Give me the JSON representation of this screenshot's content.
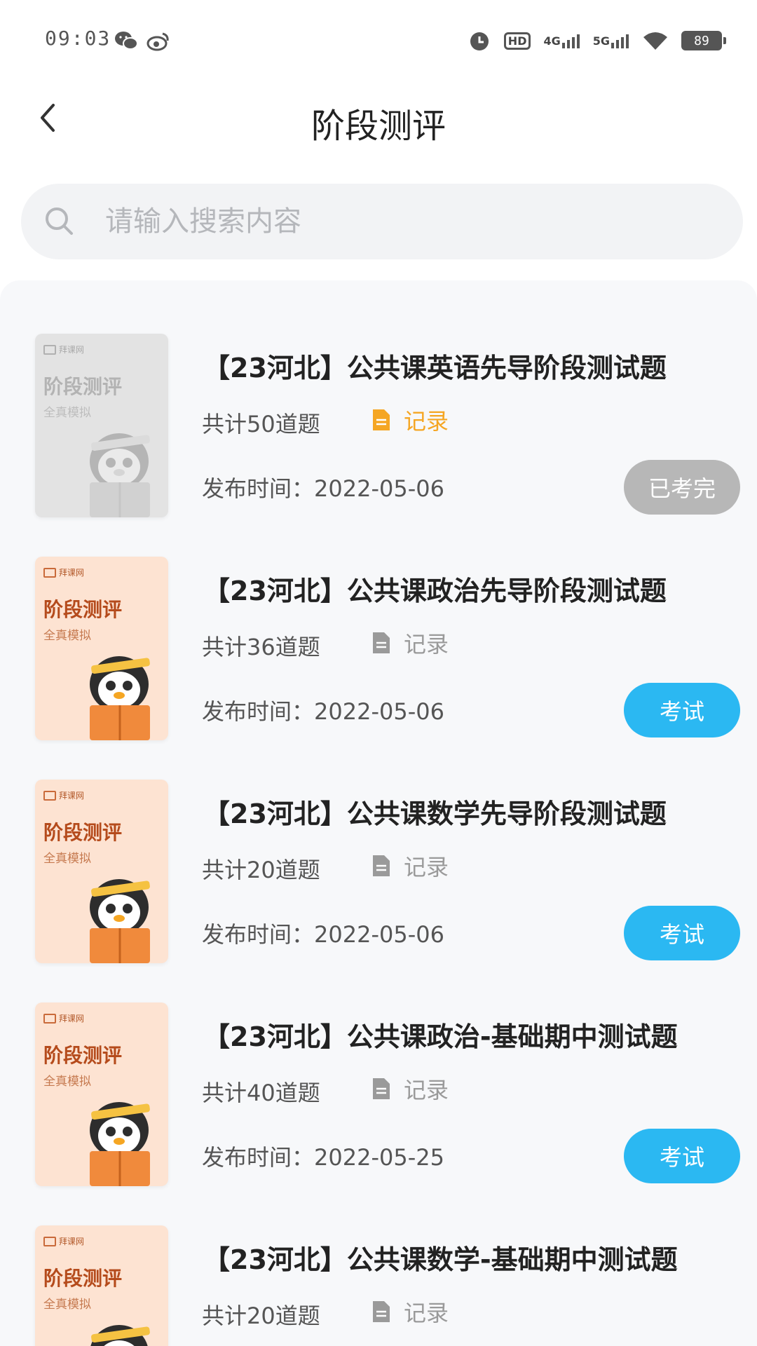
{
  "status_bar": {
    "time": "09:03",
    "left_icons": [
      "wechat-icon",
      "weibo-icon"
    ],
    "right_icons": [
      "alarm-icon",
      "hd-icon",
      "signal-4g-icon",
      "signal-5g-icon",
      "wifi-icon"
    ],
    "hd_label": "HD",
    "net1_label": "4G",
    "net2_label": "5G",
    "battery": "89"
  },
  "header": {
    "title": "阶段测评",
    "back_icon": "chevron-left-icon"
  },
  "search": {
    "placeholder": "请输入搜索内容",
    "icon": "search-icon"
  },
  "colors": {
    "accent_blue": "#2bb8f2",
    "done_gray": "#b7b7b7",
    "record_active": "#f5a623"
  },
  "cover": {
    "brand": "拜课网",
    "title": "阶段测评",
    "subtitle": "全真模拟"
  },
  "items": [
    {
      "title": "【23河北】公共课英语先导阶段测试题",
      "count": "共计50道题",
      "record": "记录",
      "date": "发布时间：2022-05-06",
      "button": "已考完",
      "status": "done"
    },
    {
      "title": "【23河北】公共课政治先导阶段测试题",
      "count": "共计36道题",
      "record": "记录",
      "date": "发布时间：2022-05-06",
      "button": "考试",
      "status": "exam"
    },
    {
      "title": "【23河北】公共课数学先导阶段测试题",
      "count": "共计20道题",
      "record": "记录",
      "date": "发布时间：2022-05-06",
      "button": "考试",
      "status": "exam"
    },
    {
      "title": "【23河北】公共课政治-基础期中测试题",
      "count": "共计40道题",
      "record": "记录",
      "date": "发布时间：2022-05-25",
      "button": "考试",
      "status": "exam"
    },
    {
      "title": "【23河北】公共课数学-基础期中测试题",
      "count": "共计20道题",
      "record": "记录"
    }
  ]
}
